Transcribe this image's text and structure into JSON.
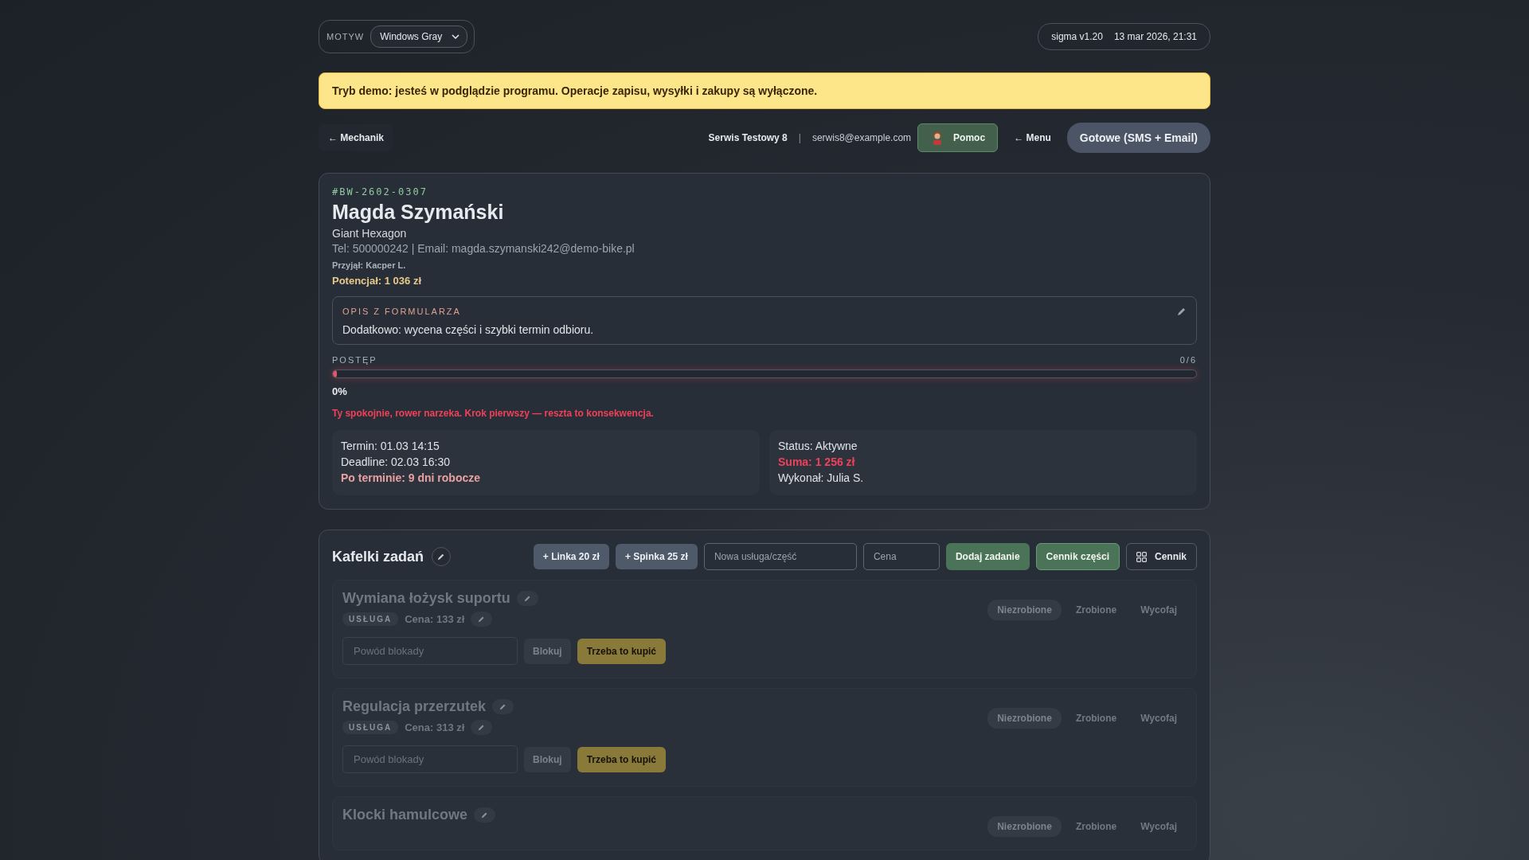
{
  "theme": {
    "label": "MOTYW",
    "value": "Windows Gray"
  },
  "version": "sigma v1.20",
  "datetime": "13 mar 2026, 21:31",
  "demo_banner": "Tryb demo: jesteś w podglądzie programu. Operacje zapisu, wysyłki i zakupy są wyłączone.",
  "nav": {
    "back": "← Mechanik",
    "service": "Serwis Testowy 8",
    "separator": "|",
    "email": "serwis8@example.com",
    "help": "Pomoc",
    "menu": "← Menu",
    "done": "Gotowe (SMS + Email)"
  },
  "order": {
    "id": "#BW-2602-0307",
    "customer": "Magda Szymański",
    "bike": "Giant Hexagon",
    "contact": "Tel: 500000242 | Email: magda.szymanski242@demo-bike.pl",
    "received_by": "Przyjął: Kacper L.",
    "potential": "Potencjał: 1 036 zł",
    "description": {
      "label": "OPIS Z FORMULARZA",
      "text": "Dodatkowo: wycena części i szybki termin odbioru."
    },
    "progress": {
      "label": "POSTĘP",
      "count": "0/6",
      "level": 0,
      "percent": "0%",
      "message": "Ty spokojnie, rower narzeka. Krok pierwszy — reszta to konsekwencja."
    },
    "info_left": [
      {
        "text": "Termin: 01.03 14:15",
        "kind": "plain"
      },
      {
        "text": "Deadline: 02.03 16:30",
        "kind": "plain"
      },
      {
        "text": "Po terminie: 9 dni robocze",
        "kind": "overdue"
      }
    ],
    "info_right": [
      {
        "text": "Status: Aktywne",
        "kind": "plain"
      },
      {
        "text": "Suma: 1 256 zł",
        "kind": "sum"
      },
      {
        "text": "Wykonał: Julia S.",
        "kind": "plain"
      }
    ]
  },
  "tasks": {
    "title": "Kafelki zadań",
    "quick_add": [
      "+ Linka 20 zł",
      "+ Spinka 25 zł"
    ],
    "name_placeholder": "Nowa usługa/część",
    "price_placeholder": "Cena",
    "add": "Dodaj zadanie",
    "parts_pricing": "Cennik części",
    "pricing": "Cennik",
    "items": [
      {
        "name": "Wymiana łożysk suportu",
        "type": "USŁUGA",
        "price": "Cena: 133 zł",
        "block_placeholder": "Powód blokady",
        "block": "Blokuj",
        "need_buy": "Trzeba to kupić",
        "statuses": [
          {
            "label": "Niezrobione",
            "selected": true
          },
          {
            "label": "Zrobione",
            "selected": false
          },
          {
            "label": "Wycofaj",
            "selected": false
          }
        ]
      },
      {
        "name": "Regulacja przerzutek",
        "type": "USŁUGA",
        "price": "Cena: 313 zł",
        "block_placeholder": "Powód blokady",
        "block": "Blokuj",
        "need_buy": "Trzeba to kupić",
        "statuses": [
          {
            "label": "Niezrobione",
            "selected": true
          },
          {
            "label": "Zrobione",
            "selected": false
          },
          {
            "label": "Wycofaj",
            "selected": false
          }
        ]
      },
      {
        "name": "Klocki hamulcowe",
        "statuses": [
          {
            "label": "Niezrobione",
            "selected": true
          },
          {
            "label": "Zrobione",
            "selected": false
          },
          {
            "label": "Wycofaj",
            "selected": false
          }
        ]
      }
    ]
  }
}
